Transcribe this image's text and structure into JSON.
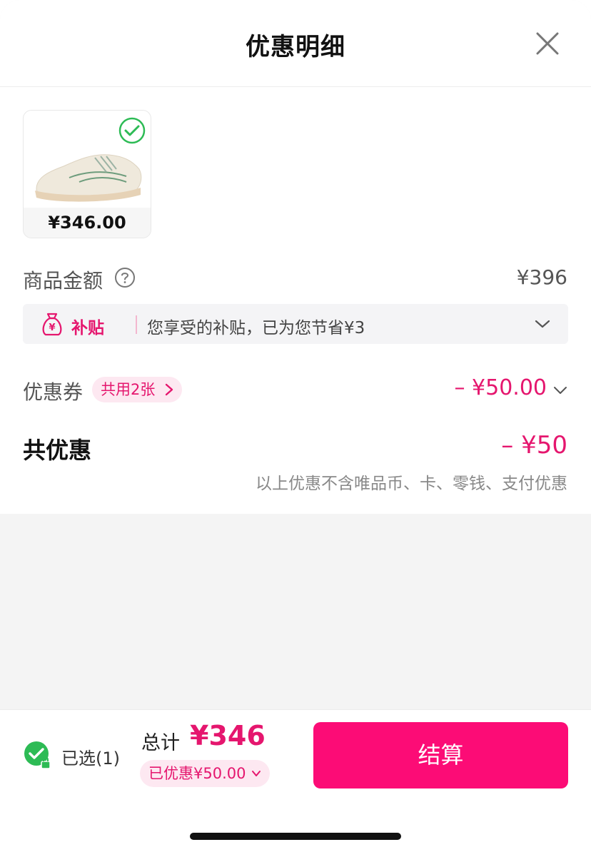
{
  "header": {
    "title": "优惠明细"
  },
  "product": {
    "price": "¥346.00"
  },
  "goods_amount": {
    "label": "商品金额",
    "value": "¥396"
  },
  "subsidy": {
    "tag": "补贴",
    "text": "您享受的补贴，已为您节省¥3"
  },
  "coupon": {
    "label": "优惠券",
    "chip": "共用2张",
    "value": "– ¥50.00"
  },
  "total_discount": {
    "label": "共优惠",
    "value": "– ¥50",
    "note": "以上优惠不含唯品币、卡、零钱、支付优惠"
  },
  "footer": {
    "selected_label": "已选(1)",
    "total_label": "总计",
    "total_value": "¥346",
    "saved_label": "已优惠¥50.00",
    "checkout_label": "结算"
  },
  "colors": {
    "accent": "#fc0c76",
    "accent_text": "#e5166e",
    "check_green": "#2dbb55"
  },
  "icons": [
    "close-icon",
    "check-circle-icon",
    "help-circle-icon",
    "money-bag-icon",
    "chevron-down-icon",
    "chevron-right-icon",
    "lock-check-icon"
  ]
}
